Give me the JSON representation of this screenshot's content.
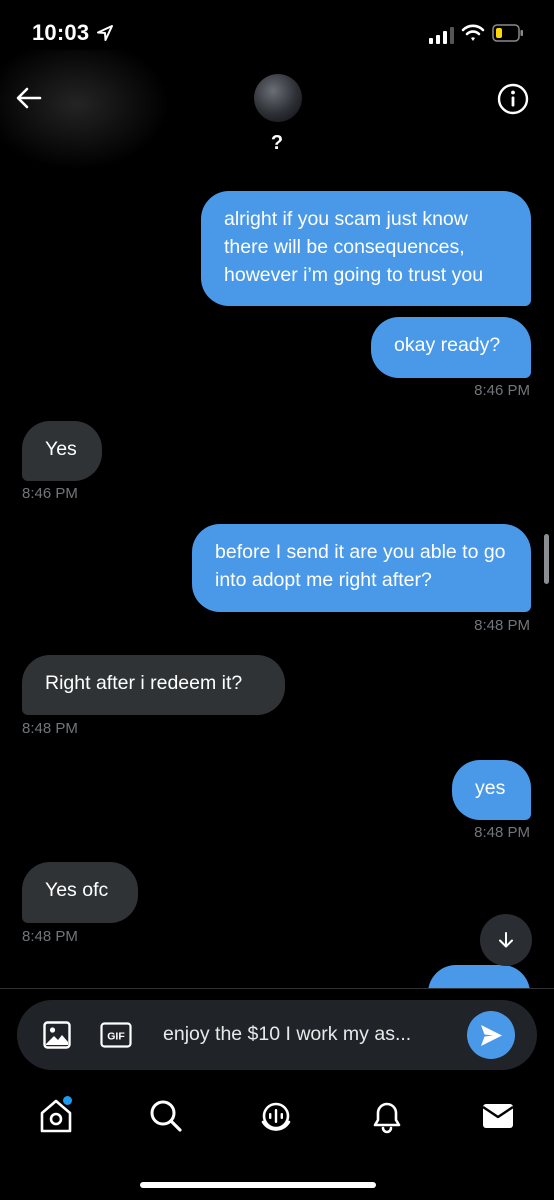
{
  "status_bar": {
    "time": "10:03"
  },
  "header": {
    "contact_name": "?"
  },
  "messages": [
    {
      "text": "alright if you scam just know there will be consequences, however i’m going to trust you"
    },
    {
      "text": "okay ready?",
      "timestamp": "8:46 PM"
    },
    {
      "text": "Yes",
      "timestamp": "8:46 PM"
    },
    {
      "text": "before I send it are you able to go into adopt me right after?",
      "timestamp": "8:48 PM"
    },
    {
      "text": "Right after i redeem it?",
      "timestamp": "8:48 PM"
    },
    {
      "text": "yes",
      "timestamp": "8:48 PM"
    },
    {
      "text": "Yes ofc",
      "timestamp": "8:48 PM"
    }
  ],
  "composer": {
    "draft": "enjoy the $10 I work my as..."
  },
  "colors": {
    "sent_bubble": "#4a99e9",
    "received_bubble": "#2f3336",
    "timestamp": "#71767b",
    "accent": "#1d9bf0"
  },
  "icons": [
    "location-arrow-icon",
    "signal-icon",
    "wifi-icon",
    "battery-icon",
    "back-arrow-icon",
    "info-icon",
    "arrow-down-icon",
    "image-icon",
    "gif-icon",
    "send-icon",
    "home-icon",
    "search-icon",
    "spaces-icon",
    "notifications-icon",
    "messages-icon"
  ]
}
